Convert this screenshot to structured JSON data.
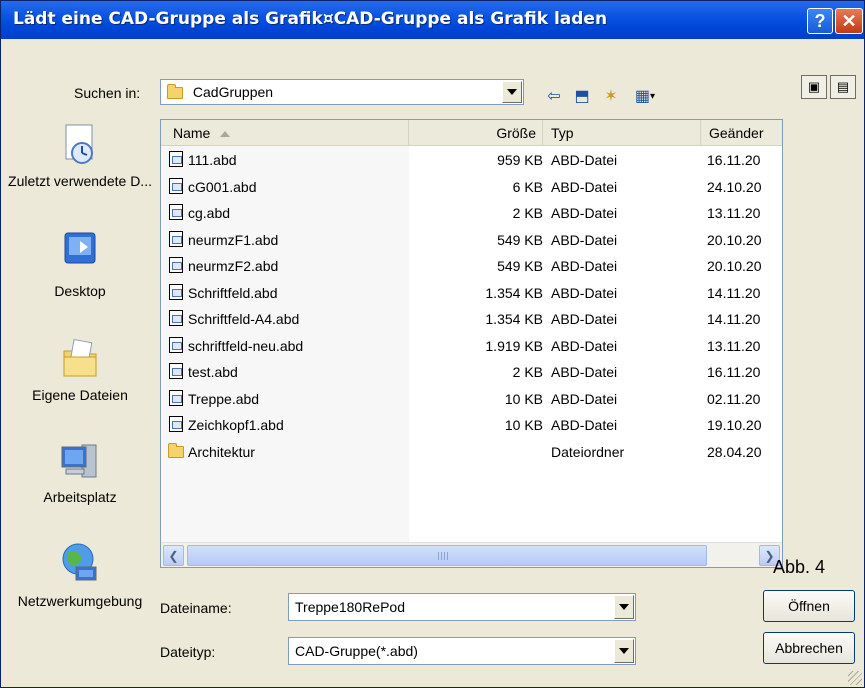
{
  "window": {
    "title": "Lädt eine CAD-Gruppe als Grafik¤CAD-Gruppe als Grafik laden",
    "help_glyph": "?",
    "close_glyph": "✕"
  },
  "lookin": {
    "label": "Suchen in:",
    "value": "CadGruppen"
  },
  "toolbar": {
    "back_glyph": "⇦",
    "up_glyph": "⬒",
    "newfolder_glyph": "✶",
    "view_glyph": "▦"
  },
  "corner_buttons": [
    "▣",
    "▤"
  ],
  "sidebar": {
    "items": [
      {
        "label": "Zuletzt verwendete D..."
      },
      {
        "label": "Desktop"
      },
      {
        "label": "Eigene Dateien"
      },
      {
        "label": "Arbeitsplatz"
      },
      {
        "label": "Netzwerkumgebung"
      }
    ]
  },
  "list": {
    "columns": [
      "Name",
      "Größe",
      "Typ",
      "Geänder"
    ],
    "rows": [
      {
        "name": "111.abd",
        "size": "959 KB",
        "type": "ABD-Datei",
        "date": "16.11.20",
        "kind": "file"
      },
      {
        "name": "cG001.abd",
        "size": "6 KB",
        "type": "ABD-Datei",
        "date": "24.10.20",
        "kind": "file"
      },
      {
        "name": "cg.abd",
        "size": "2 KB",
        "type": "ABD-Datei",
        "date": "13.11.20",
        "kind": "file"
      },
      {
        "name": "neurmzF1.abd",
        "size": "549 KB",
        "type": "ABD-Datei",
        "date": "20.10.20",
        "kind": "file"
      },
      {
        "name": "neurmzF2.abd",
        "size": "549 KB",
        "type": "ABD-Datei",
        "date": "20.10.20",
        "kind": "file"
      },
      {
        "name": "Schriftfeld.abd",
        "size": "1.354 KB",
        "type": "ABD-Datei",
        "date": "14.11.20",
        "kind": "file"
      },
      {
        "name": "Schriftfeld-A4.abd",
        "size": "1.354 KB",
        "type": "ABD-Datei",
        "date": "14.11.20",
        "kind": "file"
      },
      {
        "name": "schriftfeld-neu.abd",
        "size": "1.919 KB",
        "type": "ABD-Datei",
        "date": "13.11.20",
        "kind": "file"
      },
      {
        "name": "test.abd",
        "size": "2 KB",
        "type": "ABD-Datei",
        "date": "16.11.20",
        "kind": "file"
      },
      {
        "name": "Treppe.abd",
        "size": "10 KB",
        "type": "ABD-Datei",
        "date": "02.11.20",
        "kind": "file"
      },
      {
        "name": "Zeichkopf1.abd",
        "size": "10 KB",
        "type": "ABD-Datei",
        "date": "19.10.20",
        "kind": "file"
      },
      {
        "name": "Architektur",
        "size": "",
        "type": "Dateiordner",
        "date": "28.04.20",
        "kind": "folder"
      }
    ]
  },
  "filename": {
    "label": "Dateiname:",
    "value": "Treppe180RePod"
  },
  "filetype": {
    "label": "Dateityp:",
    "value": "CAD-Gruppe(*.abd)"
  },
  "buttons": {
    "open": "Öffnen",
    "cancel": "Abbrechen"
  },
  "annotation": "Abb. 4"
}
